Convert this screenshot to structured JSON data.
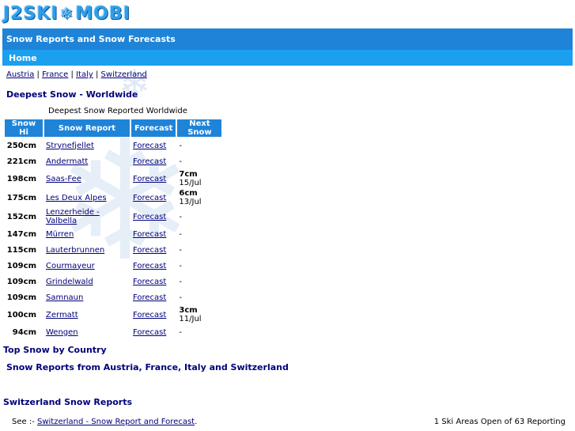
{
  "logo": {
    "left": "J2SKI",
    "right": "MOBI"
  },
  "header": {
    "title": "Snow Reports and Snow Forecasts",
    "nav_home": "Home"
  },
  "countries": [
    {
      "label": "Austria"
    },
    {
      "label": "France"
    },
    {
      "label": "Italy"
    },
    {
      "label": "Switzerland"
    }
  ],
  "deepest": {
    "heading": "Deepest Snow - Worldwide",
    "caption": "Deepest Snow Reported Worldwide",
    "columns": [
      "Snow Hi",
      "Snow Report",
      "Forecast",
      "Next Snow"
    ],
    "rows": [
      {
        "depth": "250cm",
        "resort": "Strynefjellet",
        "forecast": "Forecast",
        "next_amount": "",
        "next_date": "-"
      },
      {
        "depth": "221cm",
        "resort": "Andermatt",
        "forecast": "Forecast",
        "next_amount": "",
        "next_date": "-"
      },
      {
        "depth": "198cm",
        "resort": "Saas-Fee",
        "forecast": "Forecast",
        "next_amount": "7cm",
        "next_date": "15/Jul"
      },
      {
        "depth": "175cm",
        "resort": "Les Deux Alpes",
        "forecast": "Forecast",
        "next_amount": "6cm",
        "next_date": "13/Jul"
      },
      {
        "depth": "152cm",
        "resort": "Lenzerheide - Valbella",
        "forecast": "Forecast",
        "next_amount": "",
        "next_date": "-"
      },
      {
        "depth": "147cm",
        "resort": "Mürren",
        "forecast": "Forecast",
        "next_amount": "",
        "next_date": "-"
      },
      {
        "depth": "115cm",
        "resort": "Lauterbrunnen",
        "forecast": "Forecast",
        "next_amount": "",
        "next_date": "-"
      },
      {
        "depth": "109cm",
        "resort": "Courmayeur",
        "forecast": "Forecast",
        "next_amount": "",
        "next_date": "-"
      },
      {
        "depth": "109cm",
        "resort": "Grindelwald",
        "forecast": "Forecast",
        "next_amount": "",
        "next_date": "-"
      },
      {
        "depth": "109cm",
        "resort": "Samnaun",
        "forecast": "Forecast",
        "next_amount": "",
        "next_date": "-"
      },
      {
        "depth": "100cm",
        "resort": "Zermatt",
        "forecast": "Forecast",
        "next_amount": "3cm",
        "next_date": "11/Jul"
      },
      {
        "depth": "94cm",
        "resort": "Wengen",
        "forecast": "Forecast",
        "next_amount": "",
        "next_date": "-"
      }
    ]
  },
  "sections": {
    "top_snow": "Top Snow by Country",
    "reports_from": "Snow Reports from Austria, France, Italy and Switzerland",
    "switzerland": "Switzerland Snow Reports"
  },
  "footer": {
    "see_prefix": "See :-",
    "see_link": "Switzerland - Snow Report and Forecast",
    "see_suffix": ".",
    "open_status": "1 Ski Areas Open of 63 Reporting"
  },
  "colors": {
    "header_bar": "#1f84d8",
    "nav_bar": "#1aa0ee",
    "heading_text": "#00007a"
  },
  "icons": [
    "snowflake-icon"
  ]
}
